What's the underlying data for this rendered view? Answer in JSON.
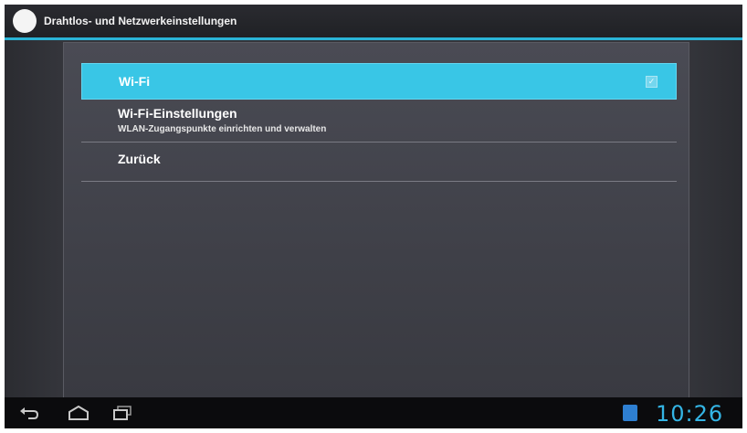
{
  "window": {
    "title": "Drahtlos- und Netzwerkeinstellungen",
    "app_icon": "circle-app-icon"
  },
  "preferences": [
    {
      "title": "Wi-Fi",
      "summary": "",
      "selected": true,
      "checkbox": true,
      "checked": true
    },
    {
      "title": "Wi-Fi-Einstellungen",
      "summary": "WLAN-Zugangspunkte einrichten und verwalten",
      "selected": false
    },
    {
      "title": "Zurück",
      "summary": "",
      "selected": false
    }
  ],
  "navbar": {
    "back_icon": "back-arrow-icon",
    "home_icon": "home-icon",
    "recents_icon": "recent-apps-icon",
    "notification_icon": "app-notification-icon",
    "clock": "10:26"
  },
  "colors": {
    "accent": "#39c6e6",
    "clock": "#34b5e5",
    "title_underline": "#2ab4d6"
  }
}
